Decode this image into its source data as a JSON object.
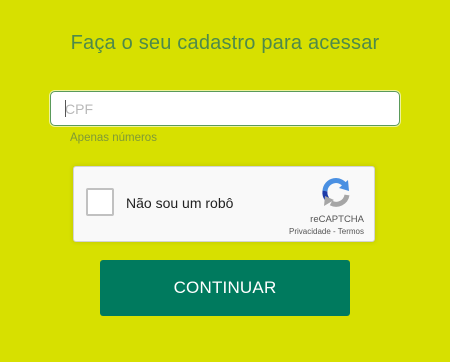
{
  "page": {
    "title": "Faça o seu cadastro para acessar"
  },
  "cpf": {
    "placeholder": "CPF",
    "value": "",
    "hint": "Apenas números"
  },
  "recaptcha": {
    "label": "Não sou um robô",
    "brand": "reCAPTCHA",
    "privacy_link": "Privacidade",
    "separator": " - ",
    "terms_link": "Termos",
    "logo_icon": "recaptcha-logo-icon"
  },
  "actions": {
    "continue_label": "CONTINUAR"
  },
  "colors": {
    "background": "#d7e000",
    "title": "#4e8a4a",
    "button": "#007a5e",
    "hint": "#7f9a35"
  }
}
